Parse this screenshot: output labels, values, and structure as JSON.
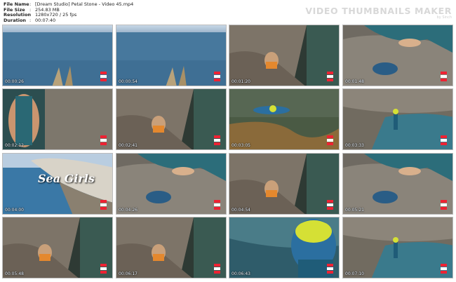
{
  "info": {
    "rows": [
      {
        "label": "File Name",
        "sep": ":",
        "value": "[Dream Studio] Petal Stone - Video 45.mp4"
      },
      {
        "label": "File Size",
        "sep": ":",
        "value": "254.83 MB"
      },
      {
        "label": "Resolution",
        "sep": ":",
        "value": "1280x720 / 25 fps"
      },
      {
        "label": "Duration",
        "sep": ":",
        "value": "00:07:40"
      }
    ]
  },
  "brand": {
    "name": "VIDEO THUMBNAILS MAKER",
    "by": "by Sinch"
  },
  "thumbnails": [
    {
      "time": "00:00:26",
      "scene": "sea"
    },
    {
      "time": "00:00:54",
      "scene": "sea"
    },
    {
      "time": "00:01:20",
      "scene": "rock-water"
    },
    {
      "time": "00:01:48",
      "scene": "rock"
    },
    {
      "time": "00:02:12",
      "scene": "rock-closeup"
    },
    {
      "time": "00:02:41",
      "scene": "rock-water"
    },
    {
      "time": "00:03:05",
      "scene": "shallow"
    },
    {
      "time": "00:03:33",
      "scene": "pool"
    },
    {
      "time": "00:04:00",
      "scene": "sea-coast",
      "overlay": "Sea Girls"
    },
    {
      "time": "00:04:26",
      "scene": "rock"
    },
    {
      "time": "00:04:54",
      "scene": "rock-water"
    },
    {
      "time": "00:05:21",
      "scene": "rock"
    },
    {
      "time": "00:05:48",
      "scene": "rock-water"
    },
    {
      "time": "00:06:17",
      "scene": "rock-water"
    },
    {
      "time": "00:06:43",
      "scene": "diver"
    },
    {
      "time": "00:07:10",
      "scene": "pool"
    }
  ]
}
